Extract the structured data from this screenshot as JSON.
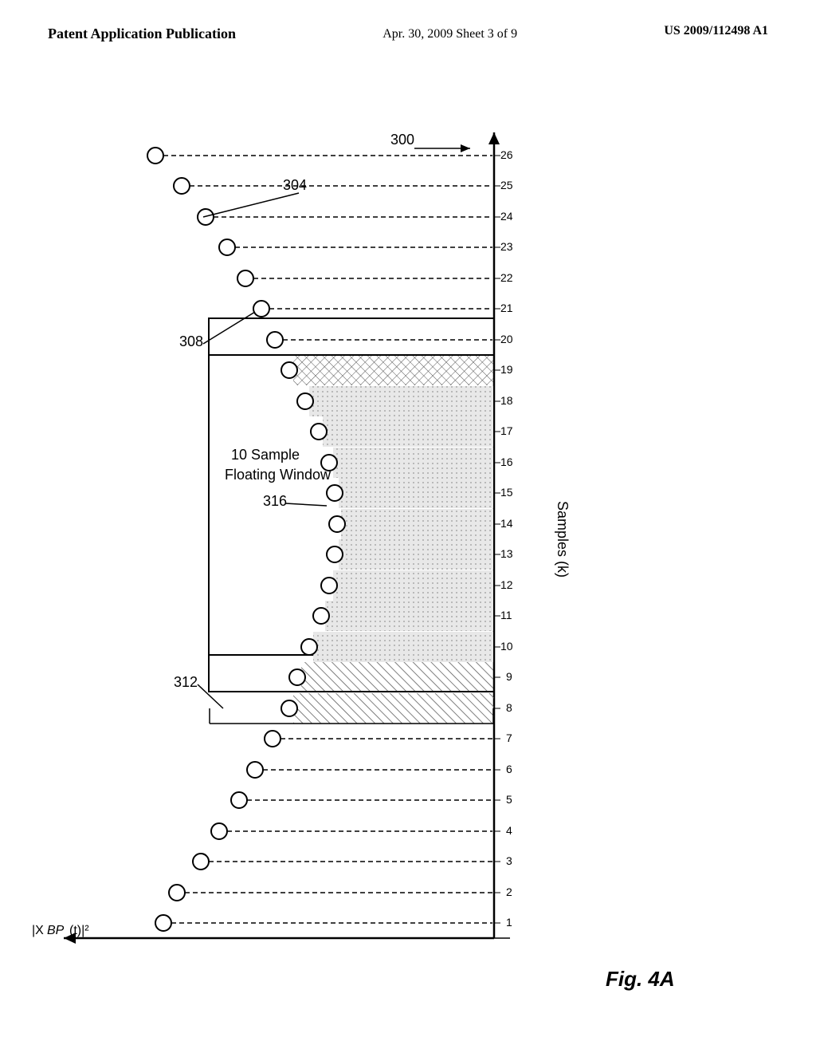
{
  "header": {
    "left_label": "Patent Application Publication",
    "center_label": "Apr. 30, 2009  Sheet 3 of 9",
    "right_label": "US 2009/112498 A1"
  },
  "diagram": {
    "title": "Fig. 4A",
    "labels": {
      "ref300": "300",
      "ref304": "304",
      "ref308": "308",
      "ref312": "312",
      "ref316": "316",
      "window_text1": "10 Sample",
      "window_text2": "Floating Window",
      "x_axis_label": "Samples (k)",
      "y_axis_label": "|X_BP(t)|²"
    },
    "sample_numbers": [
      "1",
      "2",
      "3",
      "4",
      "5",
      "6",
      "7",
      "8",
      "9",
      "10",
      "11",
      "12",
      "13",
      "14",
      "15",
      "16",
      "17",
      "18",
      "19",
      "20",
      "21",
      "22",
      "23",
      "24",
      "25",
      "26"
    ]
  }
}
